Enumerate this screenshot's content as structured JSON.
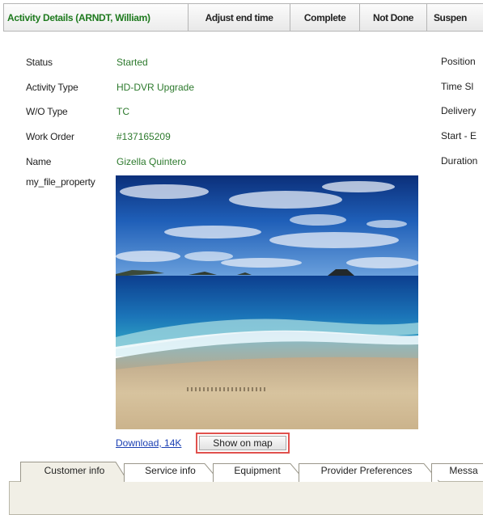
{
  "toolbar": {
    "title": "Activity Details (ARNDT, William)",
    "buttons": [
      "Adjust end time",
      "Complete",
      "Not Done",
      "Suspen"
    ]
  },
  "details": [
    {
      "label": "Status",
      "value": "Started"
    },
    {
      "label": "Activity Type",
      "value": "HD-DVR Upgrade"
    },
    {
      "label": "W/O Type",
      "value": "TC"
    },
    {
      "label": "Work Order",
      "value": "#137165209"
    },
    {
      "label": "Name",
      "value": "Gizella Quintero"
    }
  ],
  "file_property_label": "my_file_property",
  "right_labels": [
    "Position",
    "Time Sl",
    "Delivery",
    "Start - E",
    "Duration"
  ],
  "download_link": "Download, 14K",
  "show_on_map": "Show on map",
  "tabs": [
    "Customer info",
    "Service info",
    "Equipment",
    "Provider Preferences",
    "Messa"
  ],
  "colors": {
    "value_green": "#2d7a2d",
    "title_green": "#1e7a1e",
    "highlight": "#e0514d"
  }
}
